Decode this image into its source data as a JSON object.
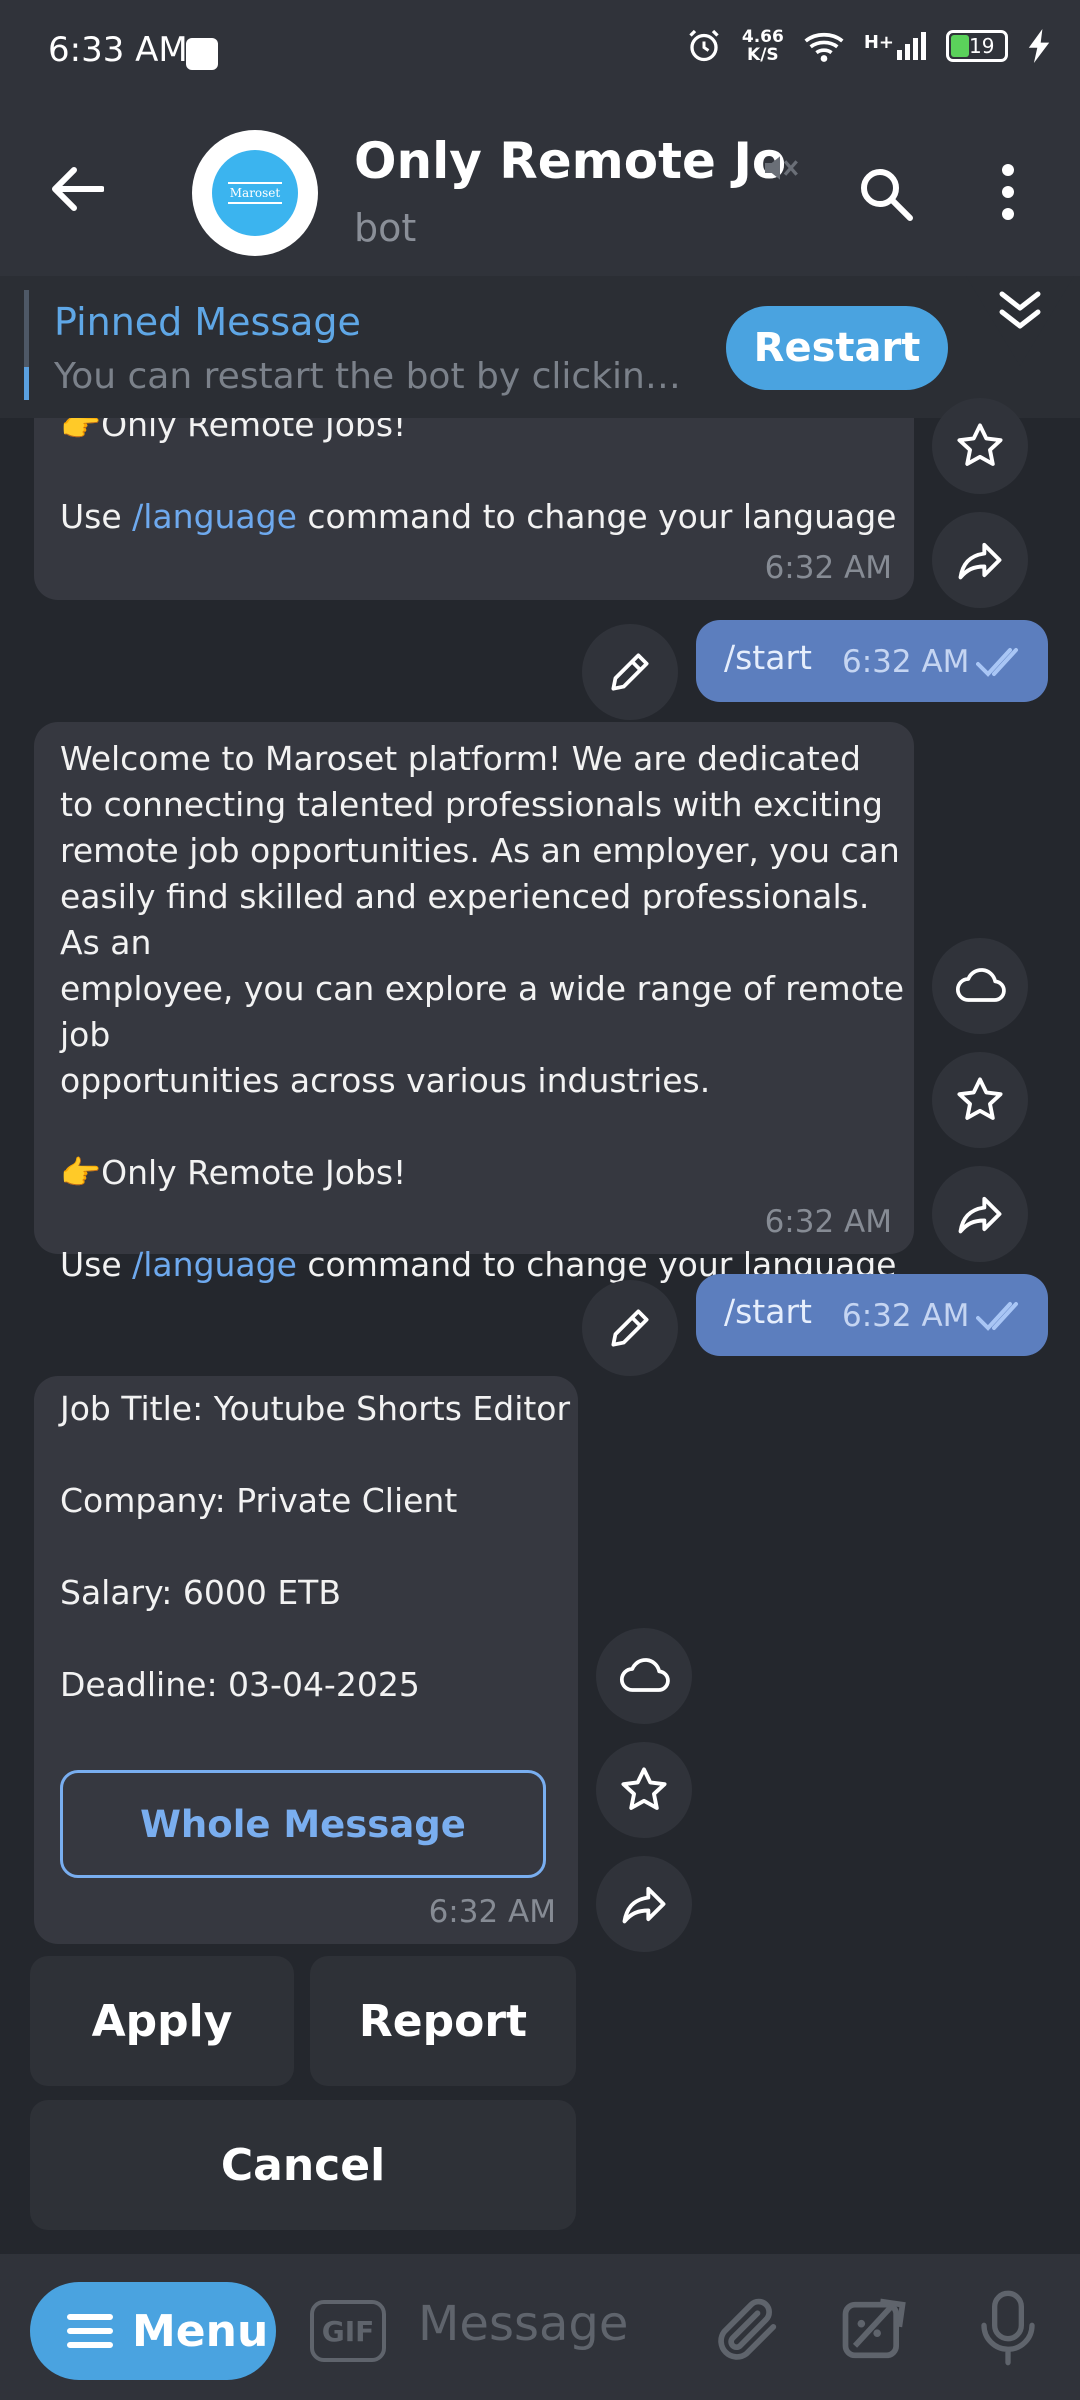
{
  "status_bar": {
    "time": "6:33 AM",
    "net_speed_value": "4.66",
    "net_speed_unit": "K/S",
    "network": "H+",
    "battery": "19"
  },
  "header": {
    "avatar_text": "Maroset",
    "title": "Only Remote Jobs",
    "subtitle": "bot"
  },
  "pinned": {
    "title": "Pinned Message",
    "text": "You can restart the bot by clickin…",
    "restart_label": "Restart"
  },
  "messages": [
    {
      "type": "in",
      "lines_part1": "👉Only Remote Jobs!",
      "prefix": "Use ",
      "link": "/language",
      "suffix": " command to change your language",
      "time": "6:32 AM"
    },
    {
      "type": "out",
      "text": "/start",
      "time": "6:32 AM"
    },
    {
      "type": "in",
      "body": "Welcome to Maroset platform! We are dedicated\nto connecting talented professionals with exciting\nremote job opportunities. As an employer, you can\neasily find skilled and experienced professionals. As an\nemployee, you can explore a wide range of remote job\nopportunities across various industries.\n\n👉Only Remote Jobs!\n",
      "prefix": "Use ",
      "link": "/language",
      "suffix": " command to change your language",
      "time": "6:32 AM"
    },
    {
      "type": "out",
      "text": "/start",
      "time": "6:32 AM"
    },
    {
      "type": "in",
      "body": "Job Title: Youtube Shorts Editor\n\nCompany: Private Client\n\nSalary: 6000 ETB\n\nDeadline: 03-04-2025",
      "button": "Whole Message",
      "time": "6:32 AM"
    }
  ],
  "keyboard": {
    "apply": "Apply",
    "report": "Report",
    "cancel": "Cancel"
  },
  "input_bar": {
    "menu_label": "Menu",
    "gif_label": "GIF",
    "placeholder": "Message"
  }
}
